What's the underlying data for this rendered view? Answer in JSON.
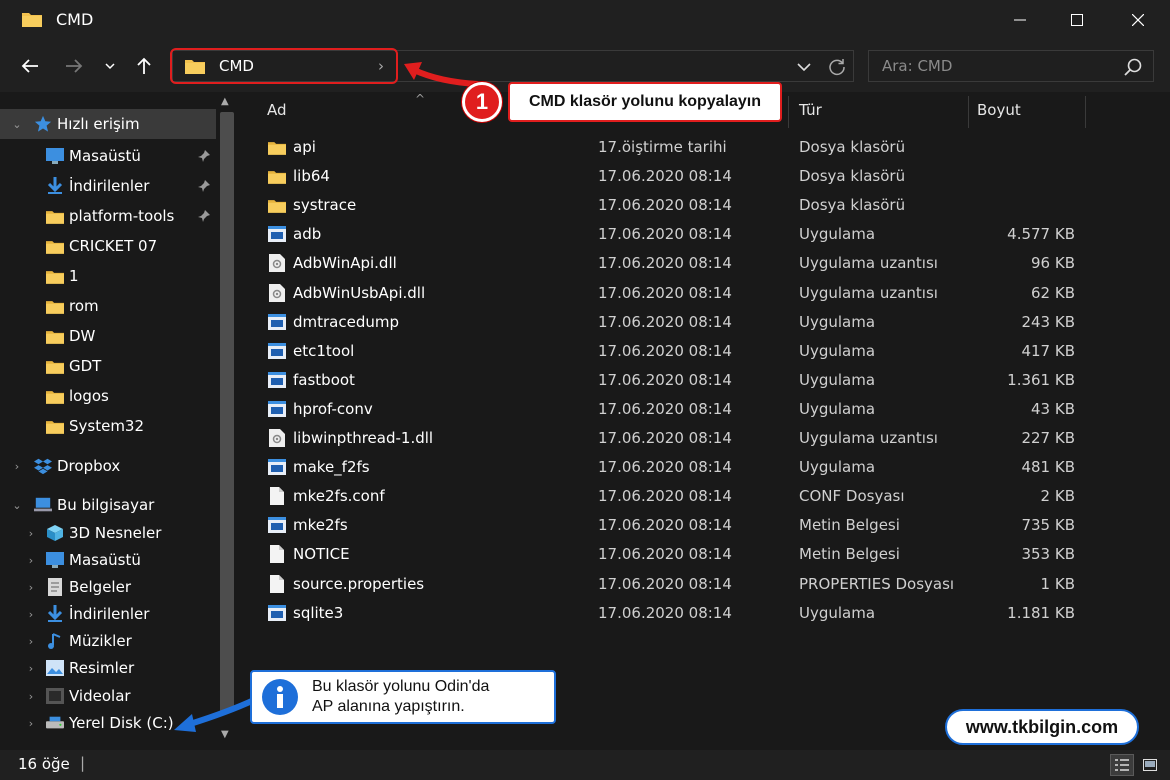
{
  "window": {
    "title": "CMD",
    "icon": "folder-icon"
  },
  "nav": {
    "address": "CMD",
    "search_placeholder": "Ara: CMD"
  },
  "sidebar": {
    "items": [
      {
        "label": "Hızlı erişim",
        "icon": "star-icon",
        "level": 0,
        "caret": "expanded",
        "selected": true
      },
      {
        "label": "Masaüstü",
        "icon": "desktop-icon",
        "level": 1,
        "pinned": true
      },
      {
        "label": "İndirilenler",
        "icon": "download-icon",
        "level": 1,
        "pinned": true
      },
      {
        "label": "platform-tools",
        "icon": "folder-icon",
        "level": 1,
        "pinned": true
      },
      {
        "label": "CRICKET 07",
        "icon": "folder-icon",
        "level": 1
      },
      {
        "label": "1",
        "icon": "folder-icon",
        "level": 1
      },
      {
        "label": "rom",
        "icon": "folder-icon",
        "level": 1
      },
      {
        "label": "DW",
        "icon": "folder-icon",
        "level": 1
      },
      {
        "label": "GDT",
        "icon": "folder-icon",
        "level": 1
      },
      {
        "label": "logos",
        "icon": "folder-icon",
        "level": 1
      },
      {
        "label": "System32",
        "icon": "folder-icon",
        "level": 1
      },
      {
        "label": "Dropbox",
        "icon": "dropbox-icon",
        "level": 0,
        "caret": "collapsed"
      },
      {
        "label": "Bu bilgisayar",
        "icon": "computer-icon",
        "level": 0,
        "caret": "expanded"
      },
      {
        "label": "3D Nesneler",
        "icon": "cube-icon",
        "level": 1,
        "caret": "collapsed"
      },
      {
        "label": "Masaüstü",
        "icon": "desktop-icon",
        "level": 1,
        "caret": "collapsed"
      },
      {
        "label": "Belgeler",
        "icon": "documents-icon",
        "level": 1,
        "caret": "collapsed"
      },
      {
        "label": "İndirilenler",
        "icon": "download-icon",
        "level": 1,
        "caret": "collapsed"
      },
      {
        "label": "Müzikler",
        "icon": "music-icon",
        "level": 1,
        "caret": "collapsed"
      },
      {
        "label": "Resimler",
        "icon": "pictures-icon",
        "level": 1,
        "caret": "collapsed"
      },
      {
        "label": "Videolar",
        "icon": "video-icon",
        "level": 1,
        "caret": "collapsed"
      },
      {
        "label": "Yerel Disk (C:)",
        "icon": "drive-icon",
        "level": 1,
        "caret": "collapsed"
      }
    ]
  },
  "columns": {
    "name": "Ad",
    "type": "Tür",
    "size": "Boyut"
  },
  "files": [
    {
      "name": "api",
      "date": "17.öiştirme tarihi",
      "type": "Dosya klasörü",
      "size": "",
      "icon": "folder-icon"
    },
    {
      "name": "lib64",
      "date": "17.06.2020 08:14",
      "type": "Dosya klasörü",
      "size": "",
      "icon": "folder-icon"
    },
    {
      "name": "systrace",
      "date": "17.06.2020 08:14",
      "type": "Dosya klasörü",
      "size": "",
      "icon": "folder-icon"
    },
    {
      "name": "adb",
      "date": "17.06.2020 08:14",
      "type": "Uygulama",
      "size": "4.577 KB",
      "icon": "application-icon"
    },
    {
      "name": "AdbWinApi.dll",
      "date": "17.06.2020 08:14",
      "type": "Uygulama uzantısı",
      "size": "96 KB",
      "icon": "dll-icon"
    },
    {
      "name": "AdbWinUsbApi.dll",
      "date": "17.06.2020 08:14",
      "type": "Uygulama uzantısı",
      "size": "62 KB",
      "icon": "dll-icon"
    },
    {
      "name": "dmtracedump",
      "date": "17.06.2020 08:14",
      "type": "Uygulama",
      "size": "243 KB",
      "icon": "application-icon"
    },
    {
      "name": "etc1tool",
      "date": "17.06.2020 08:14",
      "type": "Uygulama",
      "size": "417 KB",
      "icon": "application-icon"
    },
    {
      "name": "fastboot",
      "date": "17.06.2020 08:14",
      "type": "Uygulama",
      "size": "1.361 KB",
      "icon": "application-icon"
    },
    {
      "name": "hprof-conv",
      "date": "17.06.2020 08:14",
      "type": "Uygulama",
      "size": "43 KB",
      "icon": "application-icon"
    },
    {
      "name": "libwinpthread-1.dll",
      "date": "17.06.2020 08:14",
      "type": "Uygulama uzantısı",
      "size": "227 KB",
      "icon": "dll-icon"
    },
    {
      "name": "make_f2fs",
      "date": "17.06.2020 08:14",
      "type": "Uygulama",
      "size": "481 KB",
      "icon": "application-icon"
    },
    {
      "name": "mke2fs.conf",
      "date": "17.06.2020 08:14",
      "type": "CONF Dosyası",
      "size": "2 KB",
      "icon": "file-icon"
    },
    {
      "name": "mke2fs",
      "date": "17.06.2020 08:14",
      "type": "Metin Belgesi",
      "size": "735 KB",
      "icon": "application-icon"
    },
    {
      "name": "NOTICE",
      "date": "17.06.2020 08:14",
      "type": "Metin Belgesi",
      "size": "353 KB",
      "icon": "file-icon"
    },
    {
      "name": "source.properties",
      "date": "17.06.2020 08:14",
      "type": "PROPERTIES Dosyası",
      "size": "1 KB",
      "icon": "file-icon"
    },
    {
      "name": "sqlite3",
      "date": "17.06.2020 08:14",
      "type": "Uygulama",
      "size": "1.181 KB",
      "icon": "application-icon"
    }
  ],
  "status": {
    "count": "16 öğe"
  },
  "annotations": {
    "step_number": "1",
    "step_text": "CMD klasör yolunu kopyalayın",
    "info_line1": "Bu klasör yolunu Odin'da",
    "info_line2": "AP alanına yapıştırın.",
    "watermark": "www.tkbilgin.com",
    "highlight_color": "#e01e1e",
    "info_color": "#1e6fd9"
  },
  "colors": {
    "folder": "#f2c14e",
    "background": "#191919",
    "chrome": "#202020"
  }
}
